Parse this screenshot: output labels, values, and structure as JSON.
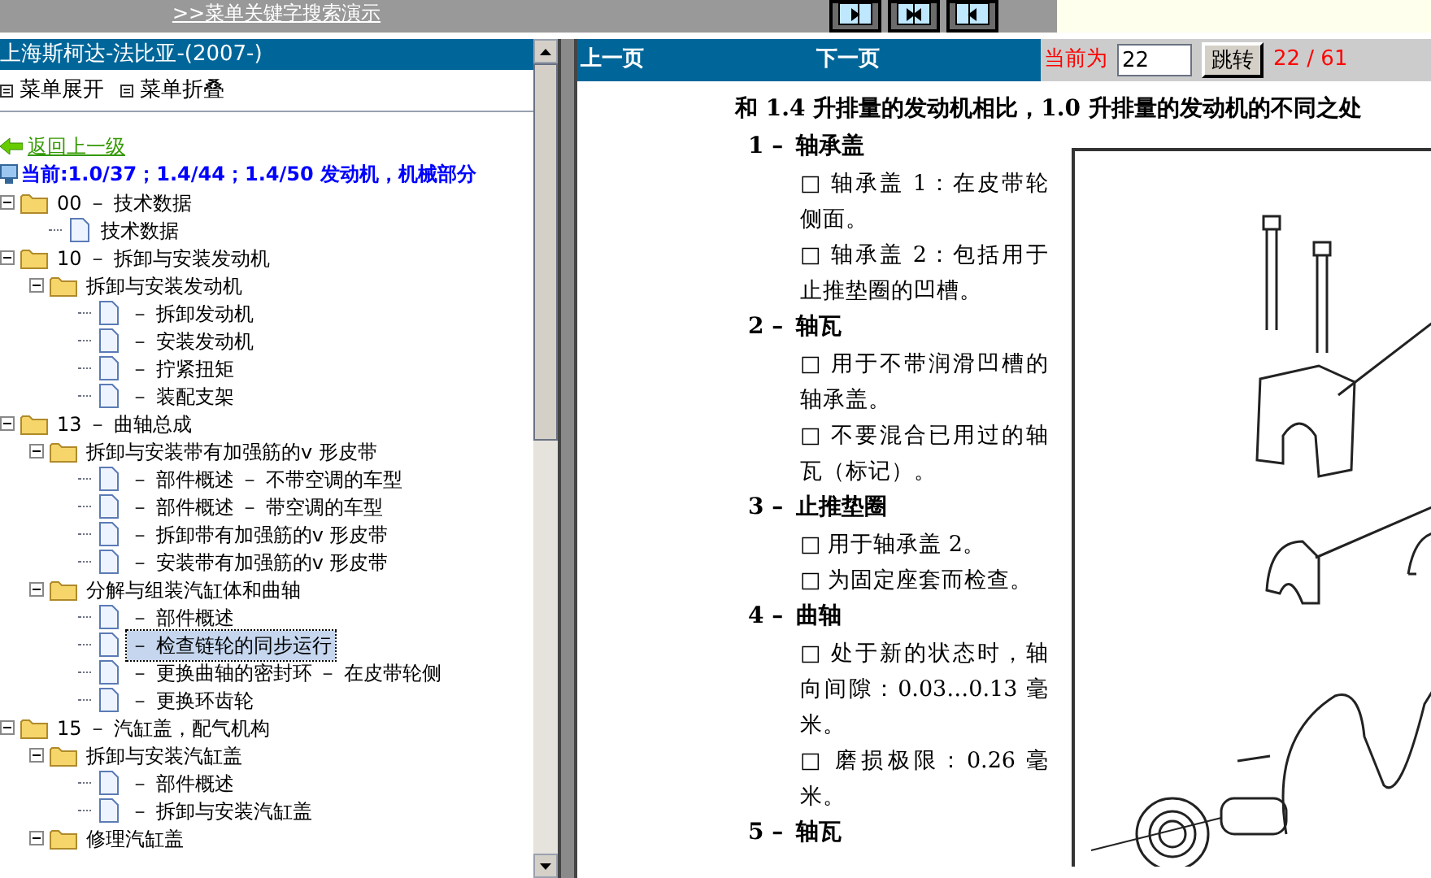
{
  "top_link": ">>菜单关键字搜索演示",
  "left": {
    "title": "上海斯柯达-法比亚-(2007-)",
    "menu_actions": [
      "菜单展开",
      "菜单折叠"
    ],
    "back_link": "返回上一级",
    "current": "当前:1.0/37；1.4/44；1.4/50 发动机，机械部分"
  },
  "tree": [
    {
      "kind": "folder",
      "label": "00 －  技术数据",
      "expanded": true,
      "children": [
        {
          "kind": "page",
          "label": "技术数据",
          "selected": false
        }
      ]
    },
    {
      "kind": "folder",
      "label": "10 －  拆卸与安装发动机",
      "expanded": true,
      "children": [
        {
          "kind": "folder",
          "label": "拆卸与安装发动机",
          "expanded": true,
          "children": [
            {
              "kind": "page",
              "label": "－ 拆卸发动机",
              "selected": false
            },
            {
              "kind": "page",
              "label": "－ 安装发动机",
              "selected": false
            },
            {
              "kind": "page",
              "label": "－ 拧紧扭矩",
              "selected": false
            },
            {
              "kind": "page",
              "label": "－ 装配支架",
              "selected": false
            }
          ]
        }
      ]
    },
    {
      "kind": "folder",
      "label": "13 －  曲轴总成",
      "expanded": true,
      "children": [
        {
          "kind": "folder",
          "label": "拆卸与安装带有加强筋的v 形皮带",
          "expanded": true,
          "children": [
            {
              "kind": "page",
              "label": "－ 部件概述  －  不带空调的车型",
              "selected": false
            },
            {
              "kind": "page",
              "label": "－ 部件概述  －  带空调的车型",
              "selected": false
            },
            {
              "kind": "page",
              "label": "－ 拆卸带有加强筋的v 形皮带",
              "selected": false
            },
            {
              "kind": "page",
              "label": "－ 安装带有加强筋的v 形皮带",
              "selected": false
            }
          ]
        },
        {
          "kind": "folder",
          "label": "分解与组装汽缸体和曲轴",
          "expanded": true,
          "children": [
            {
              "kind": "page",
              "label": "－ 部件概述",
              "selected": false
            },
            {
              "kind": "page",
              "label": "－ 检查链轮的同步运行",
              "selected": true
            },
            {
              "kind": "page",
              "label": "－ 更换曲轴的密封环 － 在皮带轮侧",
              "selected": false
            },
            {
              "kind": "page",
              "label": "－ 更换环齿轮",
              "selected": false
            }
          ]
        }
      ]
    },
    {
      "kind": "folder",
      "label": "15 －  汽缸盖，配气机构",
      "expanded": true,
      "children": [
        {
          "kind": "folder",
          "label": "拆卸与安装汽缸盖",
          "expanded": true,
          "children": [
            {
              "kind": "page",
              "label": "－ 部件概述",
              "selected": false
            },
            {
              "kind": "page",
              "label": "－ 拆卸与安装汽缸盖",
              "selected": false
            }
          ]
        },
        {
          "kind": "folder",
          "label": "修理汽缸盖",
          "expanded": true
        }
      ]
    }
  ],
  "nav": {
    "prev": "上一页",
    "next": "下一页",
    "current_label": "当前为",
    "page_value": "22",
    "jump_button": "跳转",
    "page_count": "22 / 61"
  },
  "document": {
    "heading": "和 1.4 升排量的发动机相比，1.0 升排量的发动机的不同之处",
    "items": [
      {
        "number": "1 –",
        "title": "轴承盖",
        "bullets": [
          "□ 轴承盖 1：在皮带轮侧面。",
          "□ 轴承盖 2：包括用于止推垫圈的凹槽。"
        ]
      },
      {
        "number": "2 –",
        "title": "轴瓦",
        "bullets": [
          "□ 用于不带润滑凹槽的轴承盖。",
          "□ 不要混合已用过的轴瓦（标记）。"
        ]
      },
      {
        "number": "3 –",
        "title": "止推垫圈",
        "bullets": [
          "□ 用于轴承盖 2。",
          "□ 为固定座套而检查。"
        ]
      },
      {
        "number": "4 –",
        "title": "曲轴",
        "bullets": [
          "□ 处于新的状态时，轴向间隙：0.03…0.13 毫米。",
          "□ 磨损极限：0.26 毫米。"
        ]
      },
      {
        "number": "5 –",
        "title": "轴瓦"
      }
    ]
  }
}
